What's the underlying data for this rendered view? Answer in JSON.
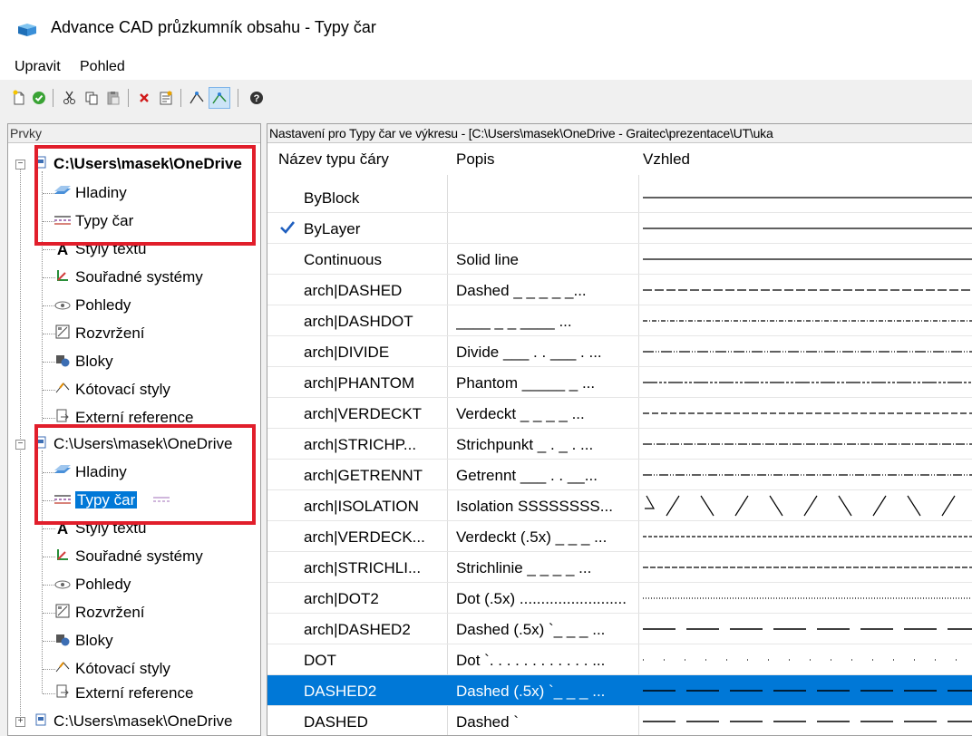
{
  "window": {
    "title": "Advance CAD průzkumník obsahu - Typy čar",
    "app_icon": "cad-cube-icon"
  },
  "menu": {
    "items": [
      "Upravit",
      "Pohled"
    ]
  },
  "toolbar": {
    "icons": [
      "new-icon",
      "check-icon",
      "cut-icon",
      "copy-icon",
      "paste-icon",
      "delete-icon",
      "properties-icon",
      "tree-link-icon",
      "tree-search-icon",
      "help-icon"
    ]
  },
  "left_pane": {
    "header": "Prvky",
    "drawings": [
      {
        "path": "C:\\Users\\masek\\OneDrive",
        "bold": true,
        "children": [
          "Hladiny",
          "Typy čar",
          "Styly textu",
          "Souřadné systémy",
          "Pohledy",
          "Rozvržení",
          "Bloky",
          "Kótovací styly",
          "Externí reference"
        ]
      },
      {
        "path": "C:\\Users\\masek\\OneDrive",
        "bold": false,
        "children": [
          "Hladiny",
          "Typy čar",
          "Styly textu",
          "Souřadné systémy",
          "Pohledy",
          "Rozvržení",
          "Bloky",
          "Kótovací styly",
          "Externí reference"
        ]
      },
      {
        "path": "C:\\Users\\masek\\OneDrive",
        "bold": false,
        "children": []
      }
    ]
  },
  "right_pane": {
    "header": "Nastavení pro Typy čar ve výkresu - [C:\\Users\\masek\\OneDrive - Graitec\\prezentace\\UT\\uka",
    "columns": [
      "Název typu čáry",
      "Popis",
      "Vzhled"
    ],
    "rows": [
      {
        "name": "ByBlock",
        "desc": "",
        "pattern": "solid",
        "current": false
      },
      {
        "name": "ByLayer",
        "desc": "",
        "pattern": "solid",
        "current": true
      },
      {
        "name": "Continuous",
        "desc": "Solid line",
        "pattern": "solid",
        "current": false
      },
      {
        "name": "arch|DASHED",
        "desc": "Dashed _ _ _ _ _...",
        "pattern": "dashed",
        "current": false
      },
      {
        "name": "arch|DASHDOT",
        "desc": "____ _ _ ____ ...",
        "pattern": "dashdot-fine",
        "current": false
      },
      {
        "name": "arch|DIVIDE",
        "desc": "Divide ___ . . ___ . ...",
        "pattern": "divide",
        "current": false
      },
      {
        "name": "arch|PHANTOM",
        "desc": "Phantom _____ _ ...",
        "pattern": "phantom",
        "current": false
      },
      {
        "name": "arch|VERDECKT",
        "desc": "Verdeckt _ _ _ _ ...",
        "pattern": "verdeckt",
        "current": false
      },
      {
        "name": "arch|STRICHP...",
        "desc": "Strichpunkt _ . _ . ...",
        "pattern": "strichpunkt",
        "current": false
      },
      {
        "name": "arch|GETRENNT",
        "desc": "Getrennt ___ . . __...",
        "pattern": "getrennt",
        "current": false
      },
      {
        "name": "arch|ISOLATION",
        "desc": "Isolation SSSSSSSS...",
        "pattern": "isolation",
        "current": false
      },
      {
        "name": "arch|VERDECK...",
        "desc": "Verdeckt (.5x) _ _ _ ...",
        "pattern": "verdeckt-half",
        "current": false
      },
      {
        "name": "arch|STRICHLI...",
        "desc": "Strichlinie _ _ _ _ ...",
        "pattern": "strichlinie",
        "current": false
      },
      {
        "name": "arch|DOT2",
        "desc": "Dot (.5x) .........................",
        "pattern": "dot-fine",
        "current": false
      },
      {
        "name": "arch|DASHED2",
        "desc": "Dashed (.5x) `_ _ _ ...",
        "pattern": "dashed-long",
        "current": false
      },
      {
        "name": "DOT",
        "desc": "Dot `. . . . . . . . . . . . ...",
        "pattern": "dot-sparse",
        "current": false
      },
      {
        "name": "DASHED2",
        "desc": "Dashed (.5x) `_ _ _ ...",
        "pattern": "dashed-long",
        "current": false,
        "selected": true
      },
      {
        "name": "DASHED",
        "desc": "Dashed `",
        "pattern": "dashed-long",
        "current": false
      }
    ]
  },
  "colors": {
    "selection": "#0078d7",
    "highlight_box": "#e11e2b",
    "checkmark": "#1f5fbf"
  }
}
